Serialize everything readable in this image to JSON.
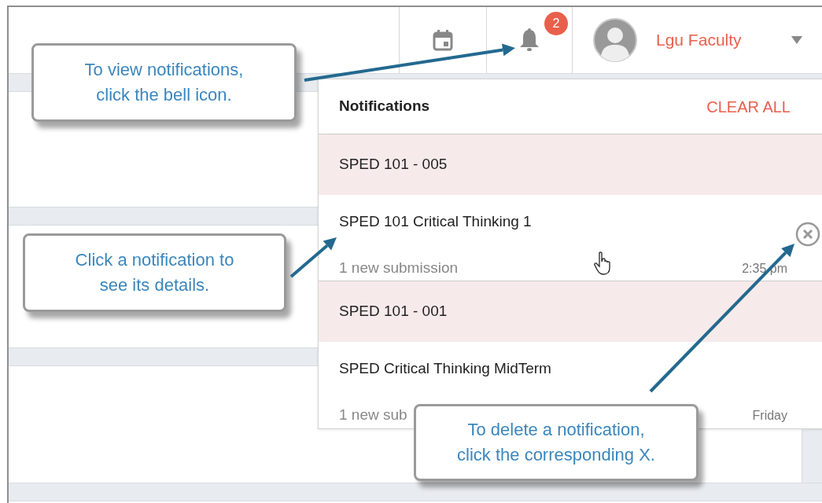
{
  "top_bar": {
    "notification_count": "2",
    "user_name": "Lgu Faculty"
  },
  "notifications_panel": {
    "title": "Notifications",
    "clear_all": "CLEAR ALL",
    "groups": [
      {
        "course": "SPED 101 - 005",
        "items": [
          {
            "title": "SPED 101 Critical Thinking 1",
            "detail": "1 new submission",
            "time": "2:35 pm",
            "hovered": true
          }
        ]
      },
      {
        "course": "SPED 101 - 001",
        "items": [
          {
            "title": "SPED Critical Thinking MidTerm",
            "detail": "1 new sub",
            "time": "Friday",
            "hovered": false
          }
        ]
      }
    ]
  },
  "callouts": [
    {
      "lines": [
        "To view notifications,",
        "click the bell icon."
      ]
    },
    {
      "lines": [
        "Click a notification to",
        "see its details."
      ]
    },
    {
      "lines": [
        "To delete a notification,",
        "click the corresponding X."
      ]
    }
  ]
}
